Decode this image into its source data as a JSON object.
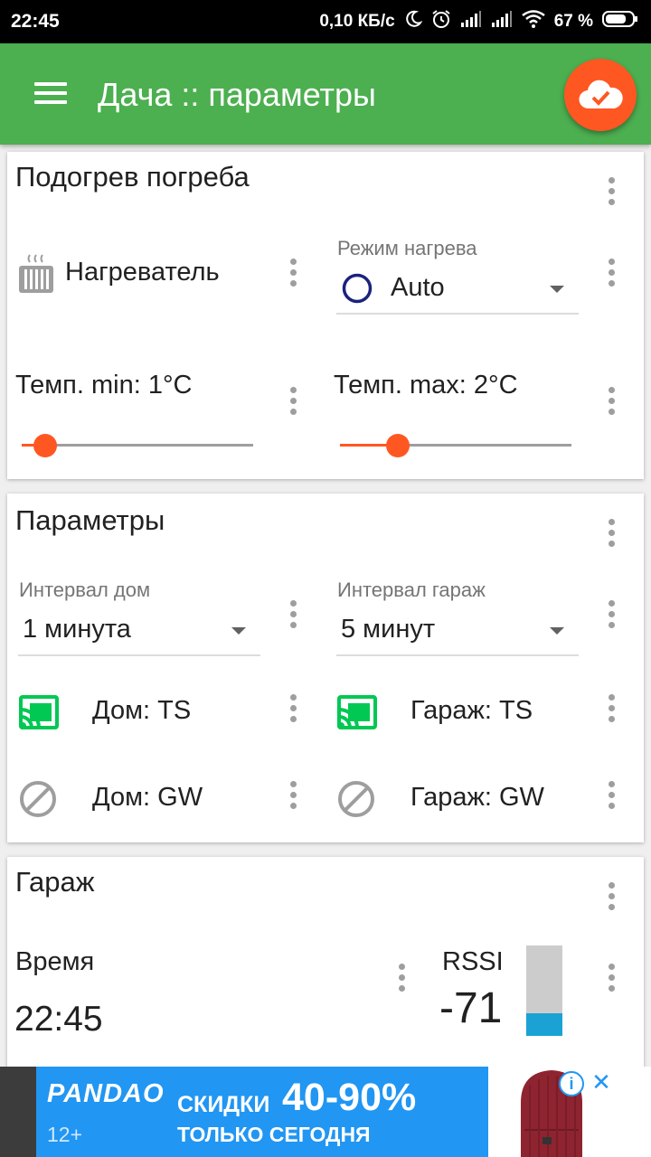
{
  "status_bar": {
    "time": "22:45",
    "net_speed": "0,10 КБ/с",
    "battery": "67 %"
  },
  "app_bar": {
    "title": "Дача :: параметры"
  },
  "cellar_card": {
    "title": "Подогрев погреба",
    "heater_label": "Нагреватель",
    "mode_caption": "Режим нагрева",
    "mode_value": "Auto",
    "temp_min_label": "Темп. min: 1°C",
    "temp_max_label": "Темп. max: 2°C",
    "temp_min_level": 0.1,
    "temp_max_level": 0.25
  },
  "params_card": {
    "title": "Параметры",
    "home_interval_caption": "Интервал дом",
    "home_interval_value": "1 минута",
    "garage_interval_caption": "Интервал гараж",
    "garage_interval_value": "5 минут",
    "home_ts_label": "Дом: TS",
    "garage_ts_label": "Гараж: TS",
    "home_gw_label": "Дом: GW",
    "garage_gw_label": "Гараж: GW"
  },
  "garage_card": {
    "title": "Гараж",
    "time_label": "Время",
    "time_value": "22:45",
    "rssi_label": "RSSI",
    "rssi_value": "-71",
    "rssi_level": 0.25
  },
  "ad": {
    "brand": "PANDAO",
    "age": "12+",
    "promo_small": "СКИДКИ",
    "promo_big": "40-90%",
    "promo_line2": "ТОЛЬКО СЕГОДНЯ"
  },
  "colors": {
    "primary": "#4caf50",
    "accent": "#ff5722",
    "cast": "#00c853",
    "radio": "#1a237e",
    "rssi_fill": "#1aa2d4"
  }
}
